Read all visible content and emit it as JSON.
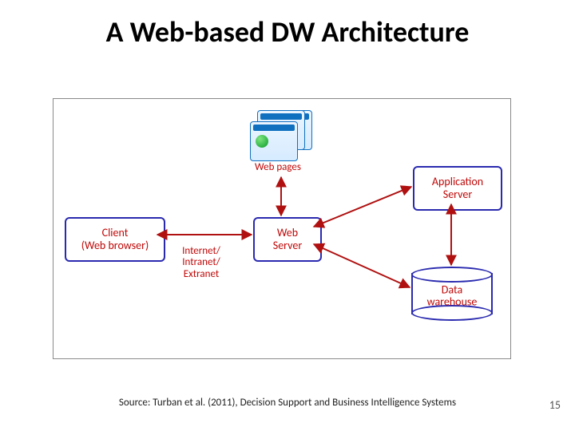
{
  "title": "A Web-based DW Architecture",
  "footer": "Source: Turban et al. (2011), Decision Support and Business Intelligence Systems",
  "page_number": "15",
  "nodes": {
    "client": "Client\n(Web browser)",
    "web_pages": "Web pages",
    "web_server": "Web\nServer",
    "app_server": "Application\nServer",
    "data_warehouse": "Data\nwarehouse",
    "link_client_web": "Internet/\nIntranet/\nExtranet"
  }
}
